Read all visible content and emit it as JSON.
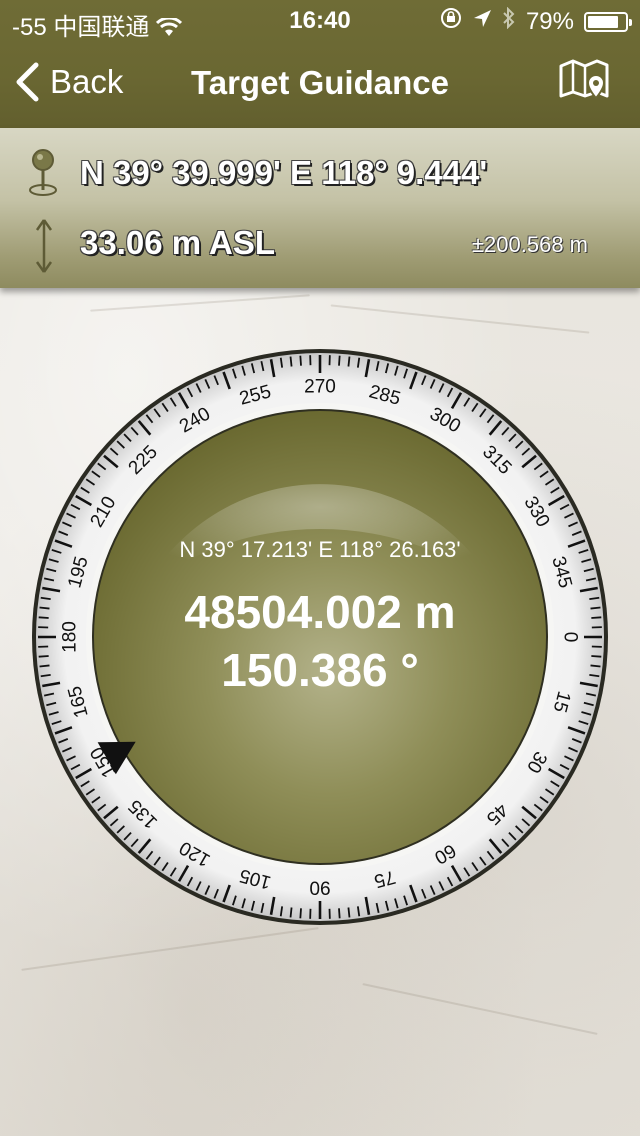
{
  "status": {
    "signal": "-55",
    "carrier": "中国联通",
    "time": "16:40",
    "battery": "79%"
  },
  "nav": {
    "back_label": "Back",
    "title": "Target Guidance"
  },
  "info": {
    "coordinates": "N 39° 39.999' E 118° 9.444'",
    "altitude": "33.06 m ASL",
    "accuracy": "±200.568 m"
  },
  "compass": {
    "target_coordinates": "N 39° 17.213' E 118° 26.163'",
    "distance": "48504.002 m",
    "bearing": "150.386 °",
    "dial_labels": [
      "0",
      "15",
      "30",
      "45",
      "60",
      "75",
      "90",
      "105",
      "120",
      "135",
      "150",
      "165",
      "180",
      "195",
      "210",
      "225",
      "240",
      "255",
      "270",
      "285",
      "300",
      "315",
      "330",
      "345"
    ],
    "dial_rotation_deg": 0,
    "pointer_bearing_deg": 150.386
  },
  "colors": {
    "nav_bg": "#6a6732",
    "accent_olive": "#7a7a3e"
  }
}
